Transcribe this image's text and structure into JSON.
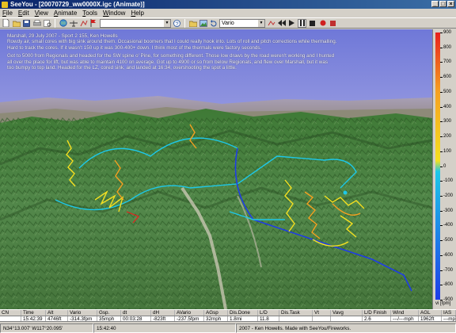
{
  "window": {
    "title": "SeeYou - [20070729_ww0000X.igc (Animate)]",
    "buttons": [
      "_",
      "□",
      "×"
    ]
  },
  "menu": [
    "File",
    "Edit",
    "View",
    "Animate",
    "Tools",
    "Window",
    "Help"
  ],
  "toolbar": {
    "left_combo_value": "",
    "vario_combo_value": "Vario"
  },
  "overlay": {
    "line1": "Marshall, 29 July 2007 - Sport 2 155, Ken Howells",
    "line2": "Rowdy air, small cores with big sink around them. Occasional boomers that I could really hook into. Lots of roll and pitch corrections while thermalling.",
    "line3": "Hard to track the cores. If it wasn't 150 up it was 300-400+ down. I think most of the thermals were factory seconds.",
    "line4": "Got to 5000 from Regionals and headed for the SW spine o' Pine, for something different. Those low draws by the road weren't working and I hunted",
    "line5": "all over the place for lift, but was able to maintain 4100 on average. Got up to 4900 or so from below Regionals, and flew over Marshall, but it was",
    "line6": "too bumpy to top land. Headed for the LZ, cored sink, and landed at 16:34, overshooting the spot a little."
  },
  "colorscale": {
    "labels": [
      "900",
      "800",
      "700",
      "600",
      "500",
      "400",
      "300",
      "200",
      "100",
      "0",
      "-100",
      "-200",
      "-300",
      "-400",
      "-500",
      "-600",
      "-700",
      "-800",
      "-900"
    ],
    "unit": "vi [fpm]",
    "colors": [
      "#e8201c",
      "#f5a020",
      "#f5e020",
      "#1ec8e8",
      "#1e3ce8"
    ]
  },
  "grid": {
    "headers": [
      "CN",
      "Time",
      "Alt",
      "Vario",
      "Gsp.",
      "dt",
      "dH",
      "AVario",
      "AGsp",
      "Dis.Done",
      "L/D",
      "Dis.Task",
      "Vt",
      "Vavg",
      "L/D Finish",
      "Wind",
      "AGL",
      "IAS"
    ],
    "values": [
      "",
      "15:42:39",
      "4746ft",
      "-314.3fpm",
      "35mph",
      "00:03:28",
      "-823ft",
      "-237.5fpm",
      "32mph",
      "1.8mi",
      "11.8",
      "",
      "",
      "",
      "2.6",
      "---/---mph",
      "1962ft",
      "---mph"
    ]
  },
  "status": {
    "coords": "N34°13.007' W117°20.095'",
    "time": "15:42:40",
    "copyright": "2007 - Ken Howells. Made with SeeYou/Fireworks."
  }
}
